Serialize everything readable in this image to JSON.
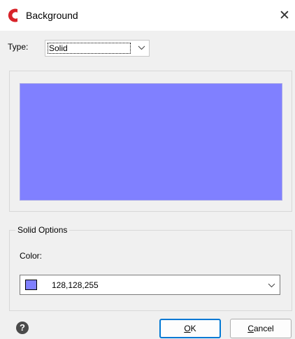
{
  "window": {
    "title": "Background",
    "icon": "app-logo-icon",
    "close_glyph": "✕"
  },
  "type_field": {
    "label": "Type:",
    "value": "Solid"
  },
  "preview": {
    "color": "#8080ff"
  },
  "solid_options": {
    "group_title": "Solid Options",
    "color_label": "Color:",
    "color_value": "128,128,255",
    "color_swatch": "#8080ff"
  },
  "buttons": {
    "help_glyph": "?",
    "ok_mnemonic": "O",
    "ok_rest": "K",
    "cancel_mnemonic": "C",
    "cancel_rest": "ancel"
  },
  "colors": {
    "accent": "#0078d4",
    "logo_red": "#d8232a"
  }
}
